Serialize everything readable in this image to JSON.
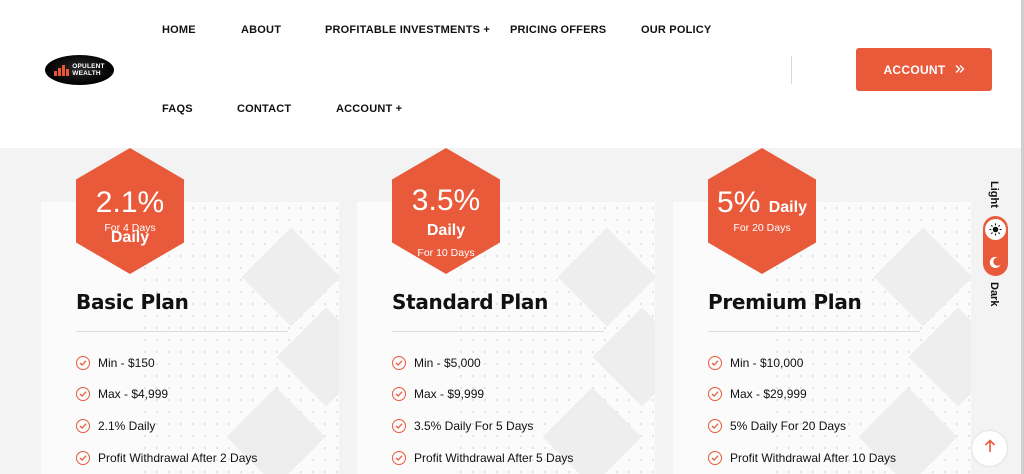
{
  "brand": {
    "logo_line1": "OPULENT",
    "logo_line2": "WEALTH",
    "accent": "#e95a3b"
  },
  "nav": {
    "row1": [
      "HOME",
      "ABOUT",
      "PROFITABLE INVESTMENTS +",
      "PRICING OFFERS",
      "OUR POLICY"
    ],
    "row2": [
      "FAQS",
      "CONTACT",
      "ACCOUNT +"
    ]
  },
  "account_button": {
    "label": "ACCOUNT",
    "icon": "double-chevron-right-icon"
  },
  "plans": [
    {
      "rate": "2.1%",
      "daily": "Daily",
      "duration": "For 4 Days",
      "name": "Basic Plan",
      "features": [
        "Min - $150",
        "Max - $4,999",
        "2.1% Daily",
        "Profit Withdrawal After 2 Days"
      ]
    },
    {
      "rate": "3.5%",
      "daily": "Daily",
      "duration": "For 10 Days",
      "name": "Standard Plan",
      "features": [
        "Min - $5,000",
        "Max - $9,999",
        "3.5% Daily For 5 Days",
        "Profit Withdrawal After 5 Days"
      ]
    },
    {
      "rate": "5%",
      "daily": "Daily",
      "duration": "For 20 Days",
      "name": "Premium Plan",
      "features": [
        "Min - $10,000",
        "Max - $29,999",
        "5% Daily For 20 Days",
        "Profit Withdrawal After 10 Days"
      ]
    }
  ],
  "theme": {
    "light_label": "Light",
    "dark_label": "Dark",
    "selected": "Light"
  },
  "scroll_top_icon": "arrow-up-icon"
}
